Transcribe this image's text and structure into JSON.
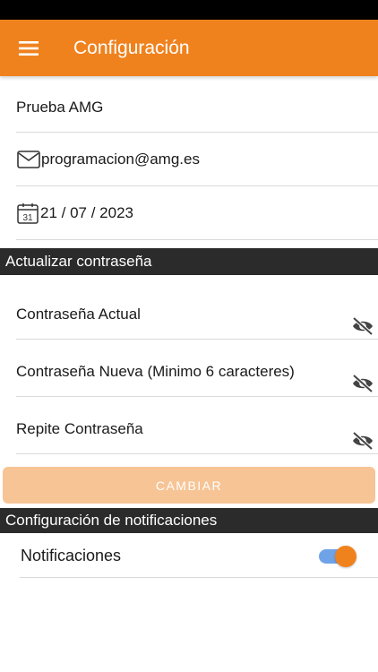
{
  "app_bar": {
    "title": "Configuración",
    "color": "#f0821e"
  },
  "profile": {
    "name": "Prueba AMG",
    "email": "programacion@amg.es",
    "date": "21 / 07 / 2023",
    "calendar_day": "31"
  },
  "password_section": {
    "header": "Actualizar contraseña",
    "fields": [
      {
        "placeholder": "Contraseña Actual",
        "icon": "eye-off-icon"
      },
      {
        "placeholder": "Contraseña Nueva (Minimo 6 caracteres)",
        "icon": "eye-off-icon"
      },
      {
        "placeholder": "Repite Contraseña",
        "icon": "eye-off-icon"
      }
    ],
    "button_label": "CAMBIAR",
    "button_color": "#f7c495"
  },
  "notifications_section": {
    "header": "Configuración de notificaciones",
    "label": "Notificaciones",
    "enabled": true
  },
  "icons": {
    "menu": "menu-icon",
    "email": "envelope-icon",
    "date": "calendar-icon"
  }
}
